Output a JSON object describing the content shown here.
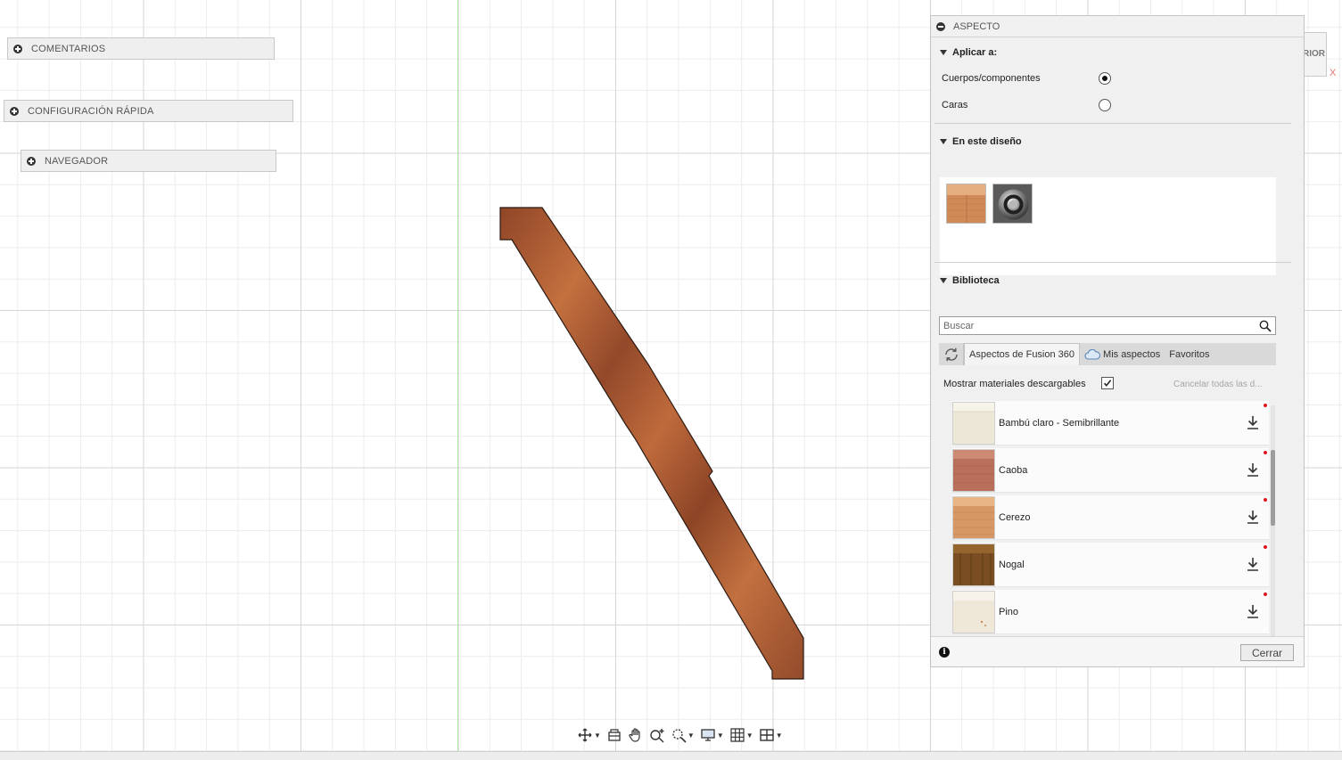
{
  "browser_panels": {
    "comments": "COMENTARIOS",
    "quick_setup": "CONFIGURACIÓN RÁPIDA",
    "navigator": "NAVEGADOR"
  },
  "viewcube": {
    "face_fragment": "RIOR",
    "axis_label": "X"
  },
  "nav_toolbar": {
    "icons": [
      "orbit-icon",
      "look-at-icon",
      "pan-icon",
      "zoom-icon",
      "fit-icon",
      "display-settings-icon",
      "grid-icon",
      "viewports-icon"
    ]
  },
  "aspect_panel": {
    "title": "ASPECTO",
    "apply_to": {
      "title": "Aplicar a:",
      "options": [
        {
          "label": "Cuerpos/componentes",
          "selected": true
        },
        {
          "label": "Caras",
          "selected": false
        }
      ]
    },
    "in_design": {
      "title": "En este diseño",
      "items": [
        "wood-appearance-swatch",
        "chrome-appearance-swatch"
      ]
    },
    "library": {
      "title": "Biblioteca",
      "search_placeholder": "Buscar",
      "tabs": [
        "Aspectos de Fusion 360",
        "Mis aspectos",
        "Favoritos"
      ],
      "active_tab": "Aspectos de Fusion 360",
      "show_downloadable_label": "Mostrar materiales descargables",
      "show_downloadable_checked": true,
      "cancel_all_label": "Cancelar todas las d...",
      "materials": [
        {
          "name": "Bambú claro - Semibrillante",
          "color": "#ece7d6"
        },
        {
          "name": "Caoba",
          "color": "#b9705a"
        },
        {
          "name": "Cerezo",
          "color": "#d89866"
        },
        {
          "name": "Nogal",
          "color": "#7a4e22"
        },
        {
          "name": "Pino",
          "color": "#efe8d8"
        },
        {
          "name": "",
          "color": "#eee9df"
        }
      ]
    },
    "footer": {
      "close_label": "Cerrar"
    }
  },
  "colors": {
    "wood_dark": "#9a4f2c",
    "wood_light": "#c06c3e",
    "axis_green": "#a9e5a0"
  }
}
